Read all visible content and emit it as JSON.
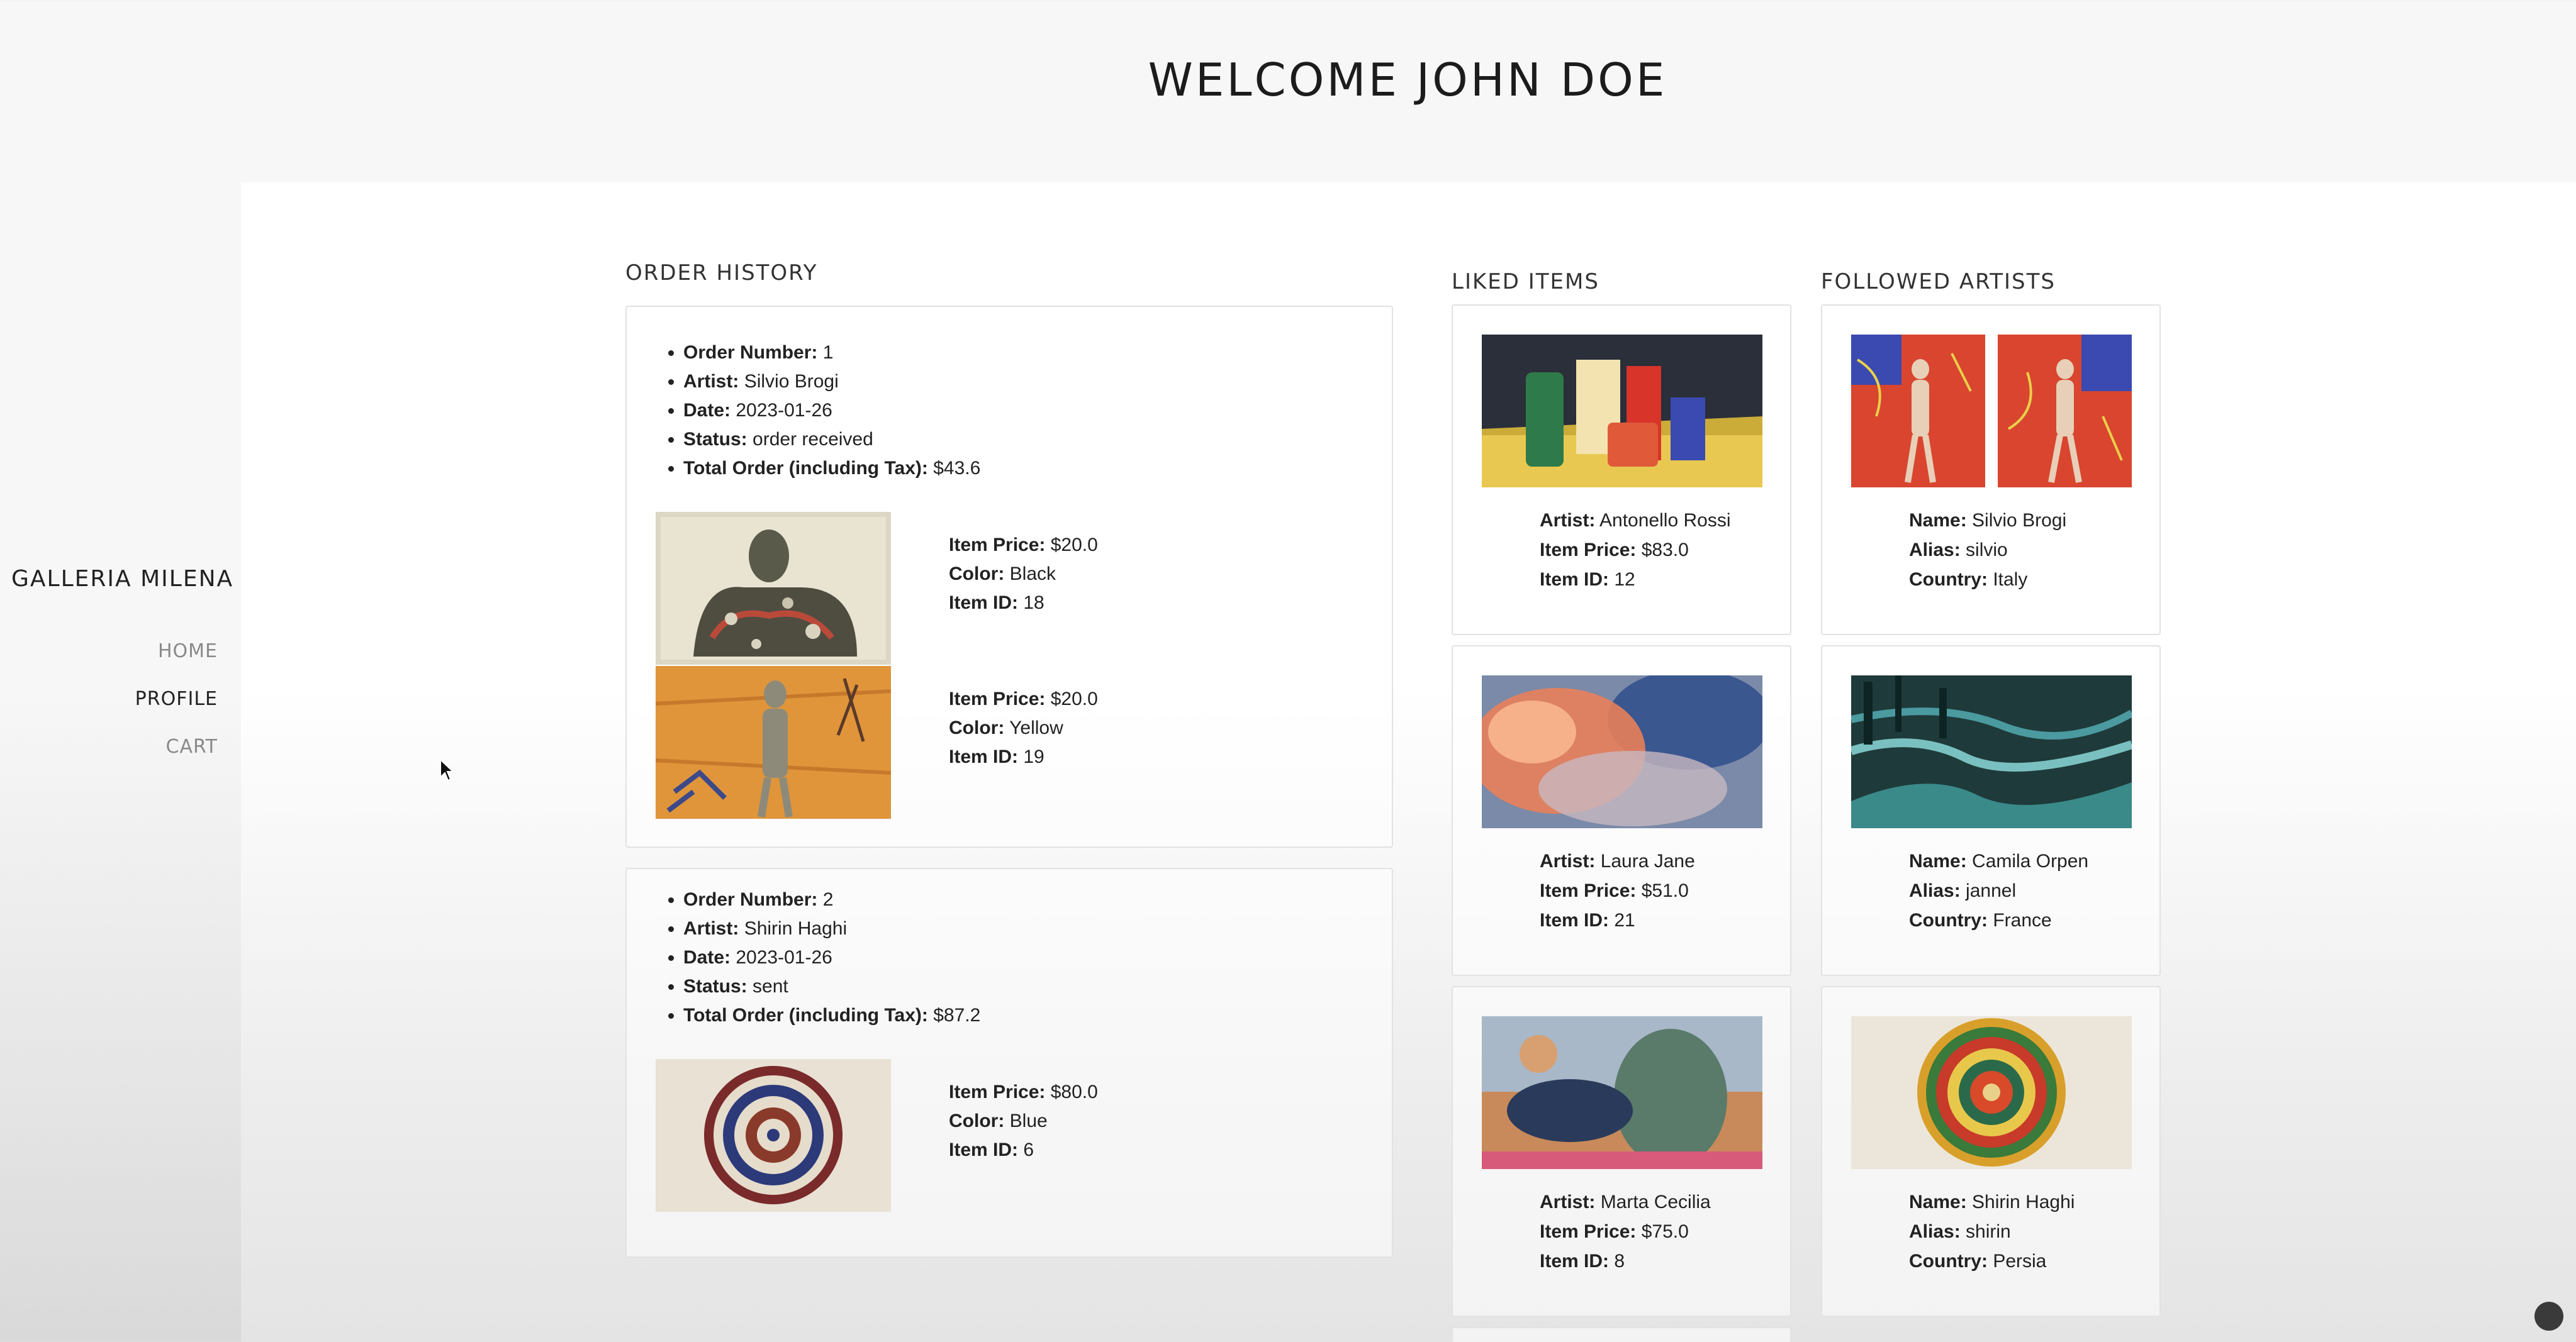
{
  "page": {
    "title": "WELCOME JOHN DOE"
  },
  "sidebar": {
    "brand": "GALLERIA MILENA",
    "nav": [
      {
        "label": "HOME",
        "active": false
      },
      {
        "label": "PROFILE",
        "active": true
      },
      {
        "label": "CART",
        "active": false
      }
    ]
  },
  "labels": {
    "order_number": "Order Number:",
    "artist": "Artist:",
    "date": "Date:",
    "status": "Status:",
    "total": "Total Order (including Tax):",
    "item_price": "Item Price:",
    "color": "Color:",
    "item_id": "Item ID:",
    "name": "Name:",
    "alias": "Alias:",
    "country": "Country:"
  },
  "order_history": {
    "title": "ORDER HISTORY",
    "orders": [
      {
        "number": "1",
        "artist": "Silvio Brogi",
        "date": "2023-01-26",
        "status": "order received",
        "total": "$43.6",
        "items": [
          {
            "price": "$20.0",
            "color": "Black",
            "id": "18",
            "image": "seated-figure-painting"
          },
          {
            "price": "$20.0",
            "color": "Yellow",
            "id": "19",
            "image": "orange-figure-painting"
          }
        ]
      },
      {
        "number": "2",
        "artist": "Shirin Haghi",
        "date": "2023-01-26",
        "status": "sent",
        "total": "$87.2",
        "items": [
          {
            "price": "$80.0",
            "color": "Blue",
            "id": "6",
            "image": "mandala-painting"
          }
        ]
      }
    ]
  },
  "liked_items": {
    "title": "LIKED ITEMS",
    "items": [
      {
        "artist": "Antonello Rossi",
        "price": "$83.0",
        "id": "12",
        "image": "still-life-bottles"
      },
      {
        "artist": "Laura Jane",
        "price": "$51.0",
        "id": "21",
        "image": "cloud-watercolor"
      },
      {
        "artist": "Marta Cecilia",
        "price": "$75.0",
        "id": "8",
        "image": "surreal-landscape"
      }
    ]
  },
  "followed_artists": {
    "title": "FOLLOWED ARTISTS",
    "artists": [
      {
        "name": "Silvio Brogi",
        "alias": "silvio",
        "country": "Italy",
        "image": "walking-figures"
      },
      {
        "name": "Camila Orpen",
        "alias": "jannel",
        "country": "France",
        "image": "green-abstract"
      },
      {
        "name": "Shirin Haghi",
        "alias": "shirin",
        "country": "Persia",
        "image": "mandala-painting"
      }
    ]
  }
}
